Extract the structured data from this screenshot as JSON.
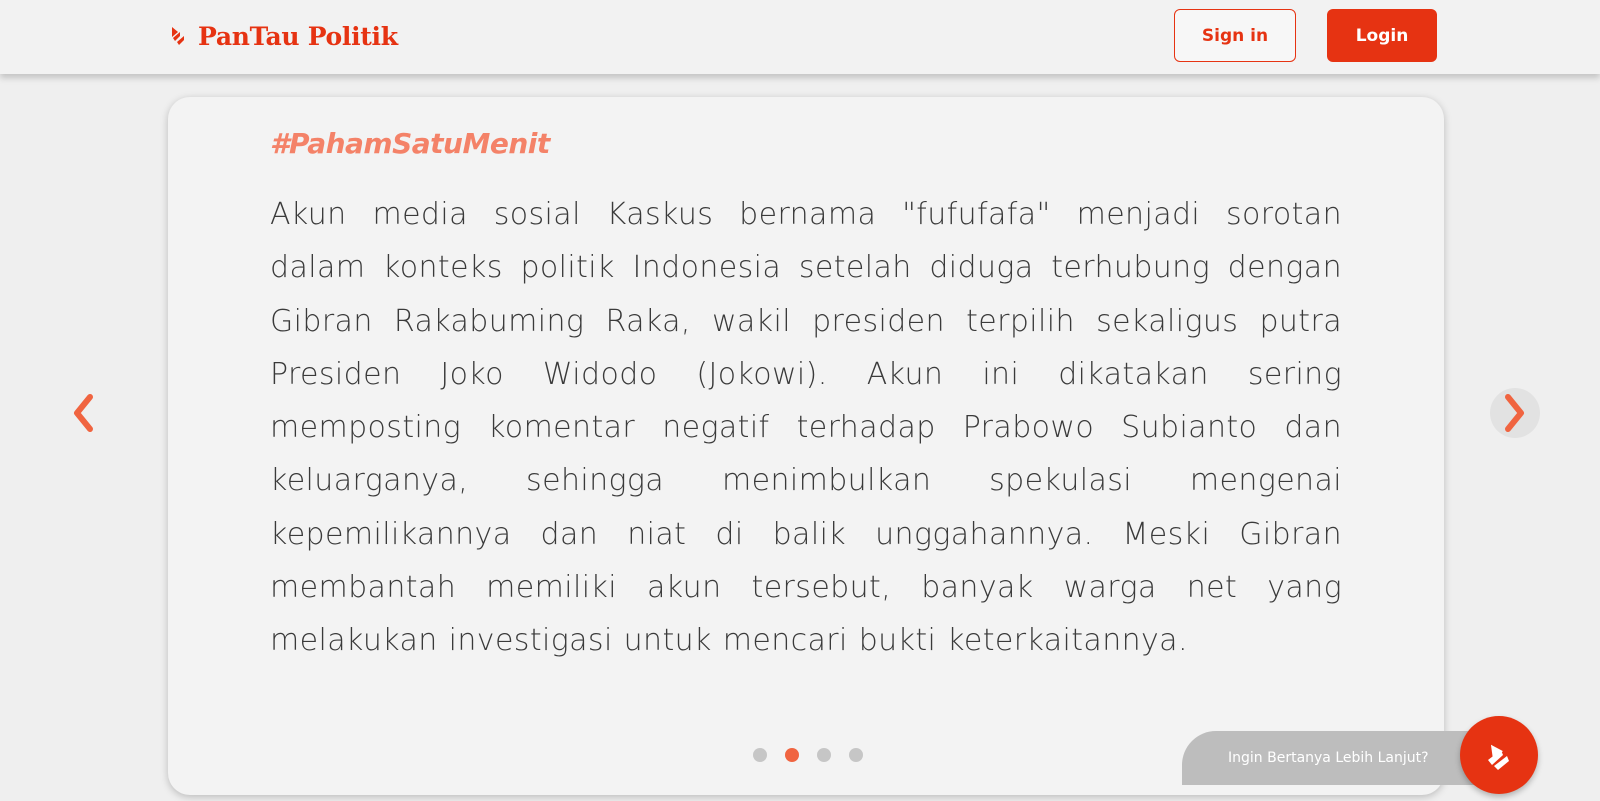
{
  "header": {
    "brand": "PanTau Politik",
    "signin_label": "Sign in",
    "login_label": "Login"
  },
  "card": {
    "hashtag": "#PahamSatuMenit",
    "body": "Akun media sosial Kaskus bernama \"fufufafa\" menjadi sorotan dalam konteks politik Indonesia setelah diduga terhubung dengan Gibran Rakabuming Raka, wakil presiden terpilih sekaligus putra Presiden Joko Widodo (Jokowi). Akun ini dikatakan sering memposting komentar negatif terhadap Prabowo Subianto dan keluarganya, sehingga menimbulkan spekulasi mengenai kepemilikannya dan niat di balik unggahannya. Meski Gibran membantah memiliki akun tersebut, banyak warga net yang melakukan investigasi untuk mencari bukti keterkaitannya."
  },
  "carousel": {
    "slide_count": 4,
    "active_index": 1
  },
  "chat": {
    "label": "Ingin Bertanya Lebih Lanjut?"
  },
  "icons": {
    "logo": "brand-flame-icon",
    "prev": "chevron-left-icon",
    "next": "chevron-right-icon",
    "chat": "brand-chat-icon"
  },
  "colors": {
    "brand": "#e63312",
    "hashtag": "#f48268",
    "dot_active": "#f06440",
    "dot_inactive": "#c6c6c6",
    "chat_pill": "#bdbdbd"
  }
}
